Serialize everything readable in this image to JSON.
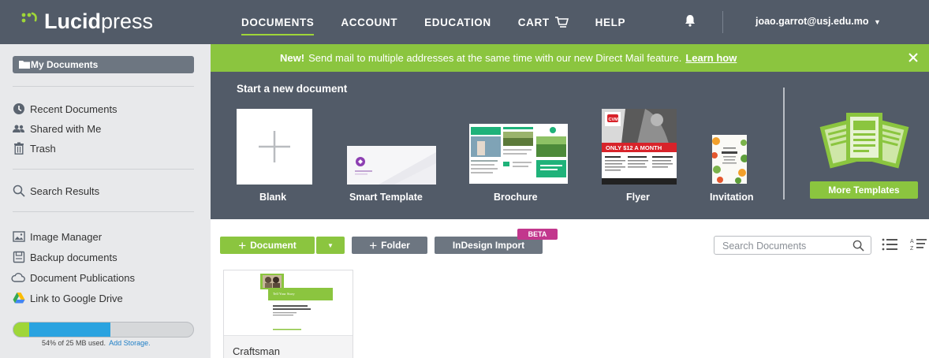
{
  "app": {
    "logo_bold": "Lucid",
    "logo_light": "press",
    "logo_mark": "⁚ˀ"
  },
  "nav": {
    "items": [
      {
        "label": "DOCUMENTS",
        "active": true
      },
      {
        "label": "ACCOUNT",
        "active": false
      },
      {
        "label": "EDUCATION",
        "active": false
      },
      {
        "label": "CART",
        "active": false
      },
      {
        "label": "HELP",
        "active": false
      }
    ],
    "user_email": "joao.garrot@usj.edu.mo",
    "icons": [
      "cart-icon",
      "bell-icon",
      "caret-down-icon"
    ]
  },
  "sidebar": {
    "my_documents": "My Documents",
    "group1": [
      "Recent Documents",
      "Shared with Me",
      "Trash"
    ],
    "search_results": "Search Results",
    "group2": [
      "Image Manager",
      "Backup documents",
      "Document Publications",
      "Link to Google Drive"
    ],
    "storage": {
      "percent_used": 54,
      "text": "54% of 25 MB used.",
      "add_link": "Add Storage."
    }
  },
  "banner": {
    "bold": "New!",
    "text": "Send mail to multiple addresses at the same time with our new Direct Mail feature.",
    "link": "Learn how"
  },
  "start": {
    "title": "Start a new document",
    "templates": [
      "Blank",
      "Smart Template",
      "Brochure",
      "Flyer",
      "Invitation"
    ],
    "more_button": "More Templates",
    "flyer_banner": "ONLY $12 A MONTH",
    "flyer_logo": "CVM"
  },
  "toolbar": {
    "new_document": "Document",
    "new_folder": "Folder",
    "indesign": "InDesign Import",
    "beta": "BETA",
    "search_placeholder": "Search Documents"
  },
  "documents": [
    {
      "name": "Craftsman",
      "thumb_text": "Tell Your Story"
    }
  ],
  "colors": {
    "nav_bg": "#525b68",
    "accent_green": "#8bc53f",
    "storage_blue": "#2aa3e0",
    "beta_magenta": "#c2378d",
    "sidebar_bg": "#e8e9eb"
  }
}
